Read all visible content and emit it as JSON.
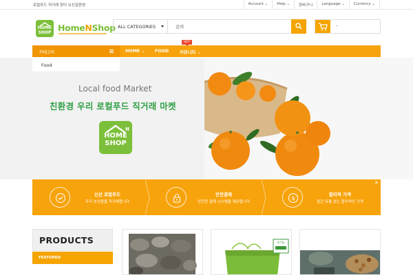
{
  "topbar": {
    "welcome": "로컬푸드 직거래 장터 오신걸환영",
    "links": [
      {
        "label": "Account",
        "has_caret": true
      },
      {
        "label": "Help",
        "has_caret": true
      },
      {
        "label": "장바구니",
        "has_caret": false
      },
      {
        "label": "Language",
        "has_caret": true
      },
      {
        "label": "Currency",
        "has_caret": true
      }
    ]
  },
  "header": {
    "logo_badge_line1": "HOME",
    "logo_badge_line2": "SHOP",
    "logo_text_a": "Home",
    "logo_text_b": "N",
    "logo_text_c": "Shop",
    "search": {
      "category": "ALL CATEGORIES",
      "placeholder": "검색",
      "button_icon": "search-icon"
    },
    "cart": {
      "icon": "cart-icon",
      "value": "-"
    }
  },
  "nav": {
    "categories_label": "카테고리",
    "items": [
      {
        "label": "HOME",
        "has_caret": true
      },
      {
        "label": "FOOD",
        "has_caret": false
      },
      {
        "label": "커뮤니티",
        "has_caret": true
      }
    ],
    "hot_badge": "HOT",
    "dropdown_items": [
      "Food"
    ]
  },
  "hero": {
    "title": "Local food Market",
    "subtitle": "친환경 우리 로컬푸드 직거래 마켓",
    "logo_line1": "HOME",
    "logo_line2": "SHOP"
  },
  "features": [
    {
      "icon": "check-circle-icon",
      "title": "신선 로컬푸드",
      "desc": "우리 농산물을 직거래합니다"
    },
    {
      "icon": "lock-icon",
      "title": "안전결제",
      "desc": "안전한 결제 시스템을 제공합니다"
    },
    {
      "icon": "dollar-coin-icon",
      "title": "합리적 가격",
      "desc": "중간 유통 없는 합리적인 가격"
    }
  ],
  "products": {
    "heading": "PRODUCTS",
    "tab": "FEATURED",
    "card_badge": "유기농"
  },
  "colors": {
    "accent": "#f7a30b",
    "accent_dark": "#f19500",
    "brand_green": "#7cbf3a",
    "hero_green": "#2e9f43"
  }
}
